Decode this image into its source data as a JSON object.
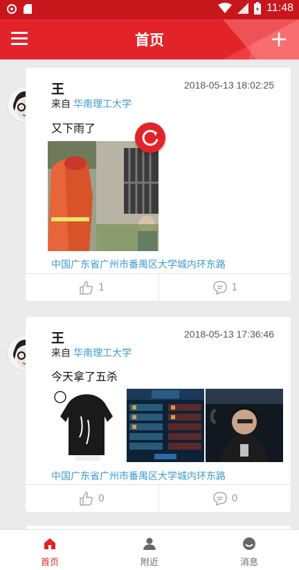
{
  "statusbar": {
    "time": "11:48"
  },
  "appbar": {
    "title": "首页",
    "menu_icon": "hamburger-icon",
    "add_icon": "plus-icon",
    "add_label": "+"
  },
  "posts": [
    {
      "author": "王",
      "timestamp": "2018-05-13 18:02:25",
      "from_label": "来自",
      "university": "华南理工大学",
      "content": "又下雨了",
      "location": "中国广东省广州市番禺区大学城内环东路",
      "likes": "1",
      "comments": "1"
    },
    {
      "author": "王",
      "timestamp": "2018-05-13 17:36:46",
      "from_label": "来自",
      "university": "华南理工大学",
      "content": "今天拿了五杀",
      "location": "中国广东省广州市番禺区大学城内环东路",
      "likes": "0",
      "comments": "0"
    }
  ],
  "tabs": [
    {
      "label": "首页",
      "icon": "home-icon",
      "active": true
    },
    {
      "label": "附近",
      "icon": "person-icon",
      "active": false
    },
    {
      "label": "消息",
      "icon": "message-icon",
      "active": false
    }
  ],
  "colors": {
    "primary": "#e2242a",
    "link": "#3c9ad1"
  }
}
